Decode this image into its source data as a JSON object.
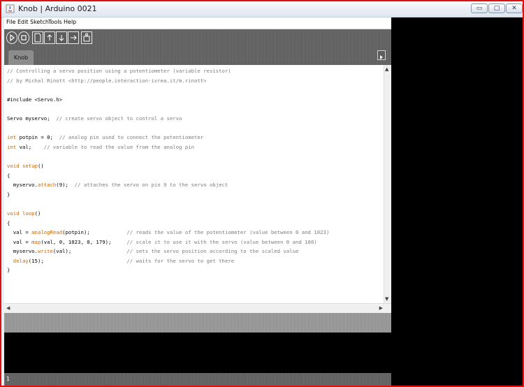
{
  "window": {
    "title": "Knob | Arduino 0021",
    "controls": {
      "minimize": "▭",
      "maximize": "□",
      "close": "✕"
    }
  },
  "menu": [
    "File",
    "Edit",
    "Sketch",
    "Tools",
    "Help"
  ],
  "toolbar": {
    "buttons": [
      "verify-icon",
      "stop-icon",
      "new-icon",
      "open-icon",
      "save-icon",
      "upload-icon",
      "serial-monitor-icon"
    ]
  },
  "tabs": [
    {
      "label": "Knob"
    }
  ],
  "status": {
    "line_number": "1"
  },
  "colors": {
    "comment": "#7e7e7e",
    "keyword": "#cc6600",
    "toolbar_bg": "#5a5a5a",
    "console_bg": "#000000"
  },
  "code": [
    "// Controlling a servo position using a potentiometer (variable resistor)",
    "// by Michal Rinott <http://people.interaction-ivrea.it/m.rinott>",
    "",
    "#include <Servo.h>",
    "",
    "Servo myservo;  // create servo object to control a servo",
    "",
    "int potpin = 0;  // analog pin used to connect the potentiometer",
    "int val;    // variable to read the value from the analog pin",
    "",
    "void setup()",
    "{",
    "  myservo.attach(9);  // attaches the servo on pin 9 to the servo object",
    "}",
    "",
    "void loop()",
    "{",
    "  val = analogRead(potpin);            // reads the value of the potentiometer (value between 0 and 1023)",
    "  val = map(val, 0, 1023, 0, 179);     // scale it to use it with the servo (value between 0 and 180)",
    "  myservo.write(val);                  // sets the servo position according to the scaled value",
    "  delay(15);                           // waits for the servo to get there",
    "}"
  ]
}
